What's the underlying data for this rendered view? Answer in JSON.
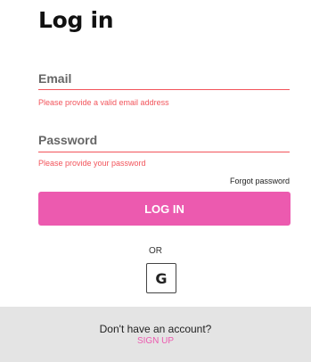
{
  "page": {
    "title": "Log in"
  },
  "form": {
    "email": {
      "label": "Email",
      "value": "",
      "error": "Please provide a valid email address"
    },
    "password": {
      "label": "Password",
      "value": "",
      "error": "Please provide your password"
    },
    "forgot_label": "Forgot password",
    "login_label": "LOG IN",
    "or_label": "OR",
    "google_glyph": "G",
    "google_icon": "google-g-icon"
  },
  "signup": {
    "prompt": "Don't have an account?",
    "link_label": "SIGN UP"
  },
  "colors": {
    "accent": "#ec5aaf",
    "error": "#f2545b",
    "panel": "#e4e4e4"
  }
}
